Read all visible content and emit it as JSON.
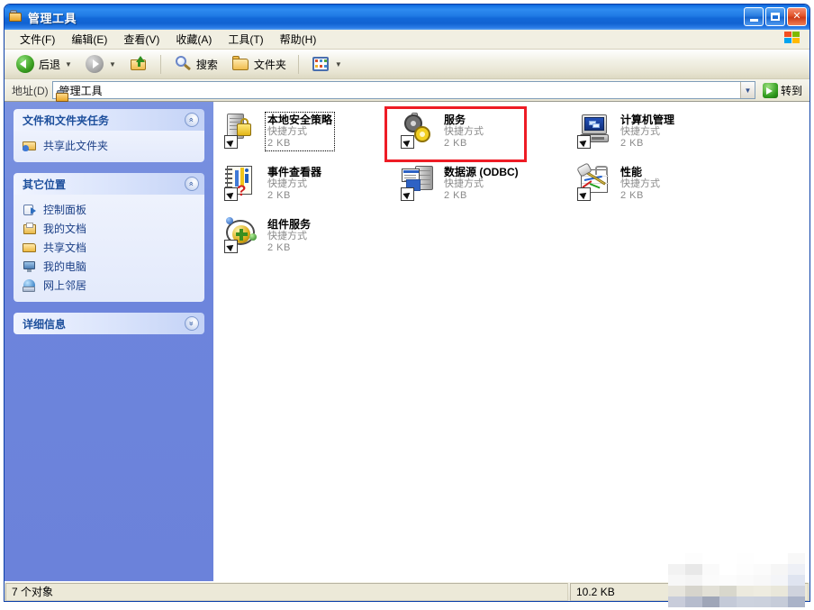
{
  "window": {
    "title": "管理工具",
    "icon": "folder-gear-icon",
    "buttons": {
      "minimize": "最小化",
      "maximize": "最大化",
      "close": "关闭"
    }
  },
  "menubar": {
    "items": [
      {
        "label": "文件(F)",
        "name": "menu-file"
      },
      {
        "label": "编辑(E)",
        "name": "menu-edit"
      },
      {
        "label": "查看(V)",
        "name": "menu-view"
      },
      {
        "label": "收藏(A)",
        "name": "menu-favorites"
      },
      {
        "label": "工具(T)",
        "name": "menu-tools"
      },
      {
        "label": "帮助(H)",
        "name": "menu-help"
      }
    ]
  },
  "toolbar": {
    "back_label": "后退",
    "forward_label": "",
    "up_label": "",
    "search_label": "搜索",
    "folders_label": "文件夹",
    "views_label": ""
  },
  "address": {
    "label": "地址(D)",
    "value": "管理工具",
    "go_label": "转到"
  },
  "sidebar": {
    "panels": [
      {
        "title": "文件和文件夹任务",
        "collapse_glyph": "«",
        "items": [
          {
            "label": "共享此文件夹",
            "icon": "share-folder-icon"
          }
        ]
      },
      {
        "title": "其它位置",
        "collapse_glyph": "«",
        "items": [
          {
            "label": "控制面板",
            "icon": "control-panel-icon"
          },
          {
            "label": "我的文档",
            "icon": "my-documents-icon"
          },
          {
            "label": "共享文档",
            "icon": "shared-documents-icon"
          },
          {
            "label": "我的电脑",
            "icon": "my-computer-icon"
          },
          {
            "label": "网上邻居",
            "icon": "network-places-icon"
          }
        ]
      },
      {
        "title": "详细信息",
        "collapse_glyph": "»",
        "items": []
      }
    ]
  },
  "files": {
    "items": [
      {
        "name": "本地安全策略",
        "type": "快捷方式",
        "size": "2 KB",
        "icon": "local-security-policy-icon",
        "focused": true
      },
      {
        "name": "服务",
        "type": "快捷方式",
        "size": "2 KB",
        "icon": "services-icon",
        "focused": false
      },
      {
        "name": "计算机管理",
        "type": "快捷方式",
        "size": "2 KB",
        "icon": "computer-management-icon",
        "focused": false
      },
      {
        "name": "事件查看器",
        "type": "快捷方式",
        "size": "2 KB",
        "icon": "event-viewer-icon",
        "focused": false
      },
      {
        "name": "数据源 (ODBC)",
        "type": "快捷方式",
        "size": "2 KB",
        "icon": "odbc-data-sources-icon",
        "focused": false
      },
      {
        "name": "性能",
        "type": "快捷方式",
        "size": "2 KB",
        "icon": "performance-icon",
        "focused": false
      },
      {
        "name": "组件服务",
        "type": "快捷方式",
        "size": "2 KB",
        "icon": "component-services-icon",
        "focused": false
      }
    ]
  },
  "annotation": {
    "highlight_color": "#ee1c25",
    "target_item": "服务"
  },
  "statusbar": {
    "object_count": "7 个对象",
    "total_size": "10.2 KB",
    "extra": ""
  },
  "colors": {
    "titlebar_blue": "#1268d8",
    "sidebar_blue": "#6d85dc",
    "panel_header": "#d9e3fb",
    "link_text": "#1b3f86",
    "highlight_red": "#ee1c25"
  }
}
